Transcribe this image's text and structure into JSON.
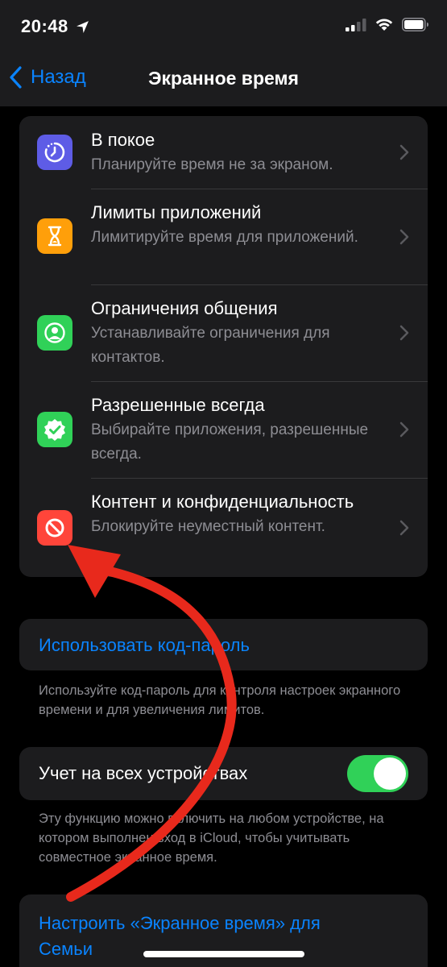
{
  "status_bar": {
    "time": "20:48",
    "icons": [
      "location-arrow-icon",
      "cellular-signal-icon",
      "wifi-icon",
      "battery-icon"
    ]
  },
  "nav": {
    "back_label": "Назад",
    "title": "Экранное время"
  },
  "settings_group": {
    "items": [
      {
        "icon": "downtime-icon",
        "icon_color": "#5e5ce6",
        "title": "В покое",
        "subtitle": "Планируйте время не за экраном."
      },
      {
        "icon": "hourglass-icon",
        "icon_color": "#ff9f0a",
        "title": "Лимиты приложений",
        "subtitle": "Лимитируйте время для приложений."
      },
      {
        "icon": "contact-person-icon",
        "icon_color": "#30d158",
        "title": "Ограничения общения",
        "subtitle": "Устанавливайте ограничения для контактов."
      },
      {
        "icon": "checkmark-badge-icon",
        "icon_color": "#30d158",
        "title": "Разрешенные всегда",
        "subtitle": "Выбирайте приложения, разрешенные всегда."
      },
      {
        "icon": "no-entry-icon",
        "icon_color": "#ff453a",
        "title": "Контент и конфиденциальность",
        "subtitle": "Блокируйте неуместный контент."
      }
    ]
  },
  "passcode": {
    "link_label": "Использовать код-пароль",
    "footnote": "Используйте код-пароль для контроля настроек экранного времени и для увеличения лимитов."
  },
  "share_devices": {
    "label": "Учет на всех устройствах",
    "toggle_on": true,
    "toggle_color": "#30d158",
    "footnote": "Эту функцию можно включить на любом устройстве, на котором выполнен вход в iCloud, чтобы учитывать совместное экранное время."
  },
  "family": {
    "link_label": "Настроить «Экранное время» для Семьи"
  },
  "colors": {
    "accent": "#0a84ff",
    "background": "#000000",
    "cell": "#1c1c1e",
    "annotation_arrow": "#e8291c"
  }
}
